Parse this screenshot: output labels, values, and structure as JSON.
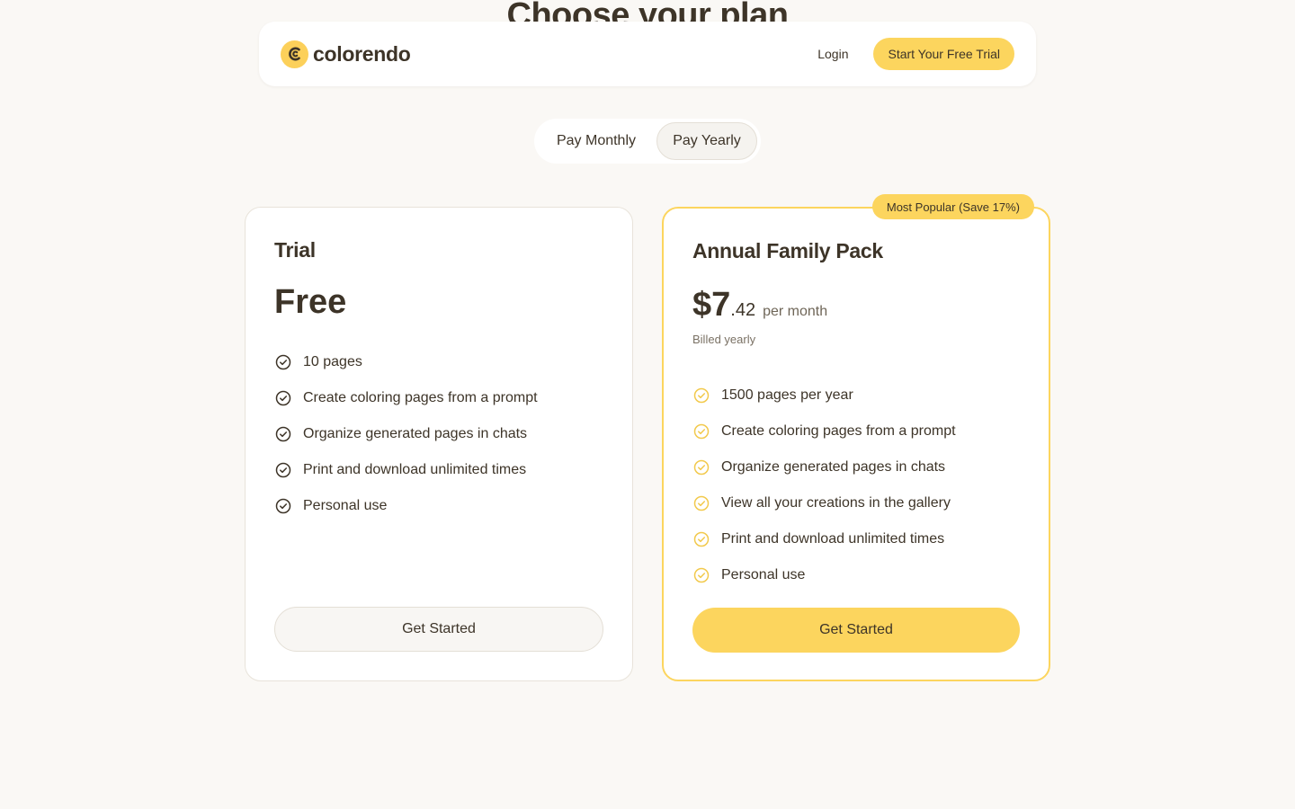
{
  "page": {
    "heading": "Choose your plan"
  },
  "header": {
    "brand_name": "colorendo",
    "login_label": "Login",
    "trial_label": "Start Your Free Trial"
  },
  "billing_toggle": {
    "options": [
      "Pay Monthly",
      "Pay Yearly"
    ],
    "selected": "Pay Yearly"
  },
  "plans": [
    {
      "name": "Trial",
      "price": "Free",
      "features": [
        "10 pages",
        "Create coloring pages from a prompt",
        "Organize generated pages in chats",
        "Print and download unlimited times",
        "Personal use"
      ],
      "cta": "Get Started"
    },
    {
      "name": "Annual Family Pack",
      "badge": "Most Popular (Save 17%)",
      "price_main": "$7",
      "price_cents": ".42",
      "price_period": "per month",
      "billing_note": "Billed yearly",
      "features": [
        "1500 pages per year",
        "Create coloring pages from a prompt",
        "Organize generated pages in chats",
        "View all your creations in the gallery",
        "Print and download unlimited times",
        "Personal use"
      ],
      "cta": "Get Started"
    }
  ],
  "colors": {
    "accent": "#fcd55e",
    "text": "#3d3428",
    "background": "#faf8f5",
    "check_default": "#3d3428",
    "check_highlight": "#f2c94c"
  },
  "icons": {
    "logo": "colorendo-logo-icon",
    "feature_check": "check-circle-icon"
  }
}
